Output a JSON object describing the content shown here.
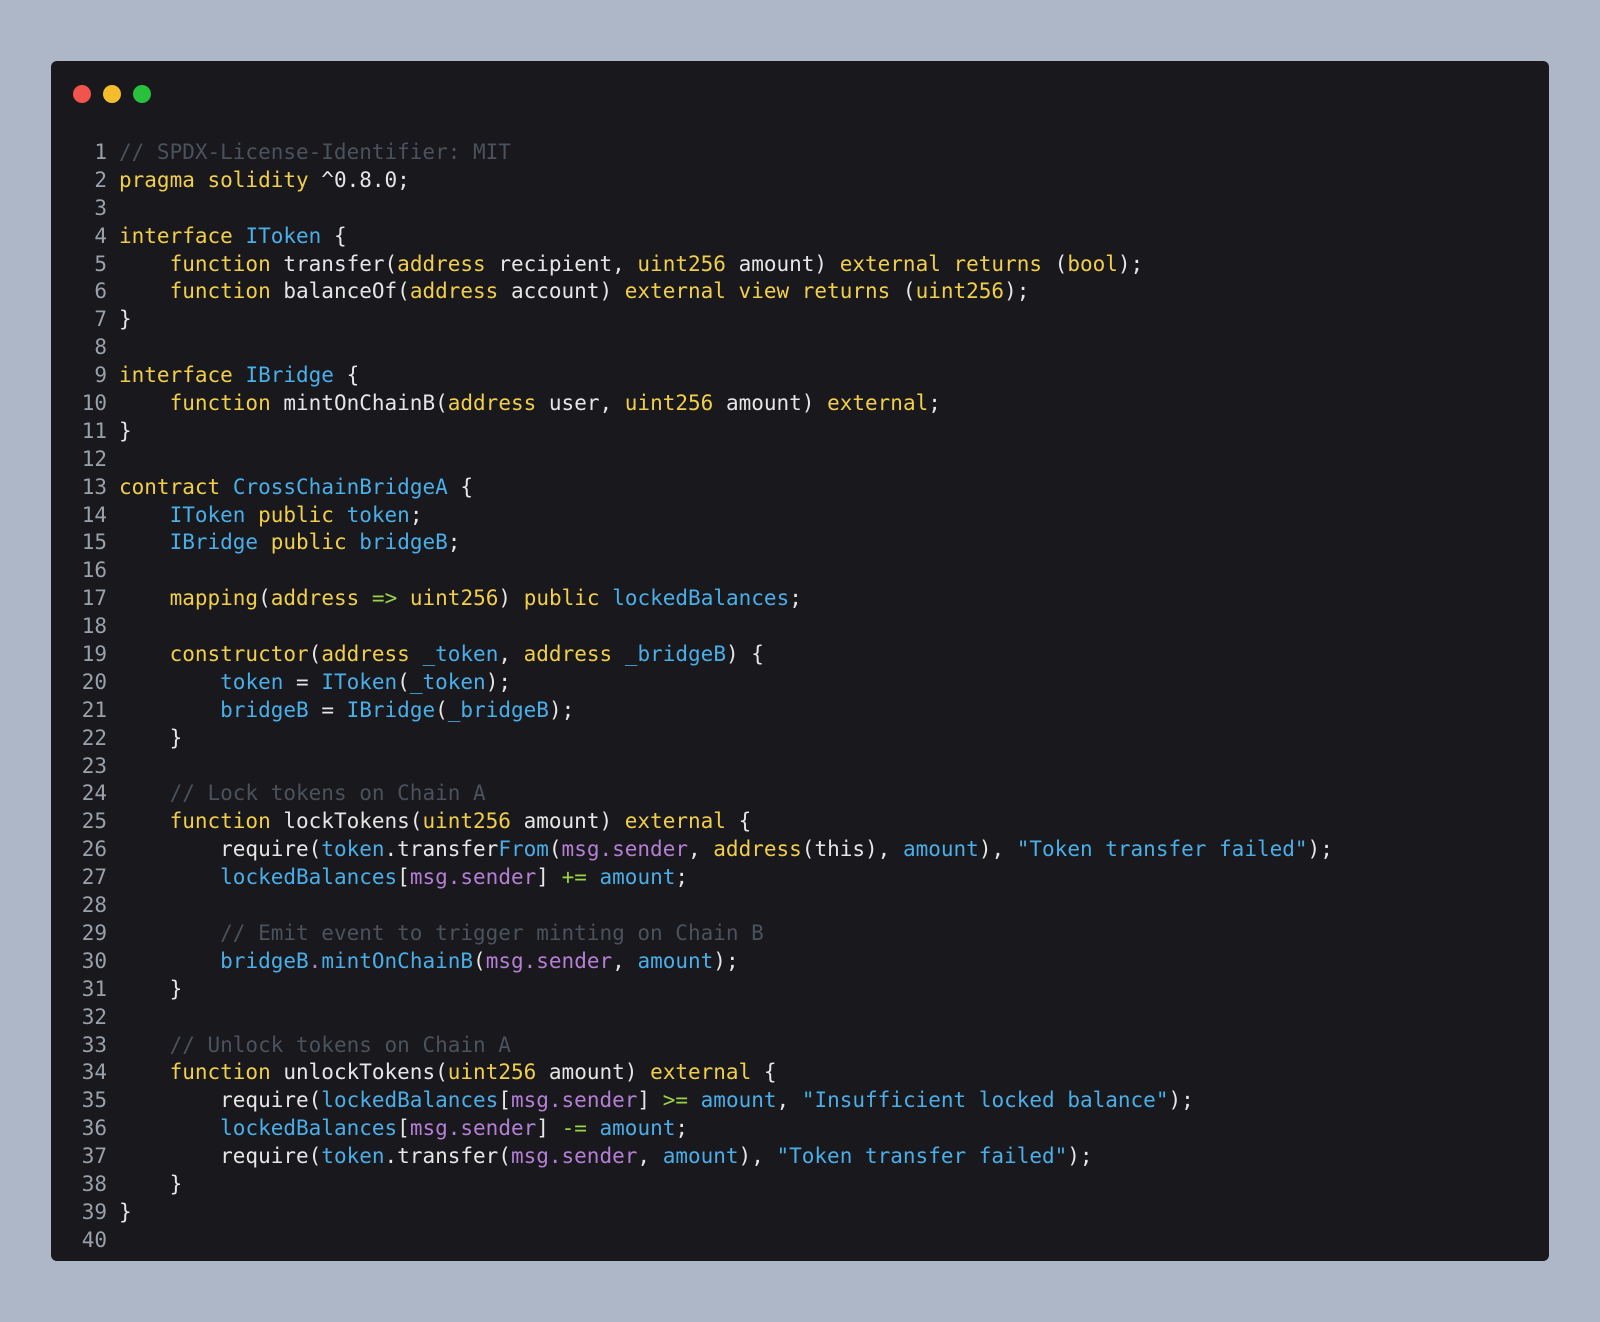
{
  "window_controls": {
    "close_color": "#f0544c",
    "minimize_color": "#f5bd2e",
    "maximize_color": "#27c13e"
  },
  "colors": {
    "background": "#adb7c8",
    "editor_background": "#18181d",
    "plain": "#e6e6e6",
    "keyword": "#f2cf4a",
    "type": "#4aaee8",
    "property": "#b57fd6",
    "string": "#4aaee8",
    "operator": "#9bd349",
    "comment": "#4b525c",
    "line_number": "#9aa1ab"
  },
  "code_lines": [
    {
      "num": "1",
      "tokens": [
        [
          "comment",
          "// SPDX-License-Identifier: MIT"
        ]
      ]
    },
    {
      "num": "2",
      "tokens": [
        [
          "kw",
          "pragma solidity"
        ],
        [
          "plain",
          " ^0.8.0;"
        ]
      ]
    },
    {
      "num": "3",
      "tokens": []
    },
    {
      "num": "4",
      "tokens": [
        [
          "kw",
          "interface"
        ],
        [
          "plain",
          " "
        ],
        [
          "type",
          "IToken"
        ],
        [
          "plain",
          " {"
        ]
      ]
    },
    {
      "num": "5",
      "tokens": [
        [
          "plain",
          "    "
        ],
        [
          "kw",
          "function"
        ],
        [
          "plain",
          " transfer("
        ],
        [
          "kw",
          "address"
        ],
        [
          "plain",
          " recipient, "
        ],
        [
          "kw",
          "uint256"
        ],
        [
          "plain",
          " amount) "
        ],
        [
          "kw",
          "external returns"
        ],
        [
          "plain",
          " ("
        ],
        [
          "kw",
          "bool"
        ],
        [
          "plain",
          ");"
        ]
      ]
    },
    {
      "num": "6",
      "tokens": [
        [
          "plain",
          "    "
        ],
        [
          "kw",
          "function"
        ],
        [
          "plain",
          " balanceOf("
        ],
        [
          "kw",
          "address"
        ],
        [
          "plain",
          " account) "
        ],
        [
          "kw",
          "external view returns"
        ],
        [
          "plain",
          " ("
        ],
        [
          "kw",
          "uint256"
        ],
        [
          "plain",
          ");"
        ]
      ]
    },
    {
      "num": "7",
      "tokens": [
        [
          "plain",
          "}"
        ]
      ]
    },
    {
      "num": "8",
      "tokens": []
    },
    {
      "num": "9",
      "tokens": [
        [
          "kw",
          "interface"
        ],
        [
          "plain",
          " "
        ],
        [
          "type",
          "IBridge"
        ],
        [
          "plain",
          " {"
        ]
      ]
    },
    {
      "num": "10",
      "tokens": [
        [
          "plain",
          "    "
        ],
        [
          "kw",
          "function"
        ],
        [
          "plain",
          " mintOnChainB("
        ],
        [
          "kw",
          "address"
        ],
        [
          "plain",
          " user, "
        ],
        [
          "kw",
          "uint256"
        ],
        [
          "plain",
          " amount) "
        ],
        [
          "kw",
          "external"
        ],
        [
          "plain",
          ";"
        ]
      ]
    },
    {
      "num": "11",
      "tokens": [
        [
          "plain",
          "}"
        ]
      ]
    },
    {
      "num": "12",
      "tokens": []
    },
    {
      "num": "13",
      "tokens": [
        [
          "kw",
          "contract"
        ],
        [
          "plain",
          " "
        ],
        [
          "type",
          "CrossChainBridgeA"
        ],
        [
          "plain",
          " {"
        ]
      ]
    },
    {
      "num": "14",
      "tokens": [
        [
          "plain",
          "    "
        ],
        [
          "type",
          "IToken"
        ],
        [
          "plain",
          " "
        ],
        [
          "kw",
          "public"
        ],
        [
          "plain",
          " "
        ],
        [
          "type",
          "token"
        ],
        [
          "plain",
          ";"
        ]
      ]
    },
    {
      "num": "15",
      "tokens": [
        [
          "plain",
          "    "
        ],
        [
          "type",
          "IBridge"
        ],
        [
          "plain",
          " "
        ],
        [
          "kw",
          "public"
        ],
        [
          "plain",
          " "
        ],
        [
          "type",
          "bridgeB"
        ],
        [
          "plain",
          ";"
        ]
      ]
    },
    {
      "num": "16",
      "tokens": []
    },
    {
      "num": "17",
      "tokens": [
        [
          "plain",
          "    "
        ],
        [
          "kw",
          "mapping"
        ],
        [
          "plain",
          "("
        ],
        [
          "kw",
          "address"
        ],
        [
          "plain",
          " "
        ],
        [
          "op",
          "=>"
        ],
        [
          "plain",
          " "
        ],
        [
          "kw",
          "uint256"
        ],
        [
          "plain",
          ") "
        ],
        [
          "kw",
          "public"
        ],
        [
          "plain",
          " "
        ],
        [
          "type",
          "lockedBalances"
        ],
        [
          "plain",
          ";"
        ]
      ]
    },
    {
      "num": "18",
      "tokens": []
    },
    {
      "num": "19",
      "tokens": [
        [
          "plain",
          "    "
        ],
        [
          "kw",
          "constructor"
        ],
        [
          "plain",
          "("
        ],
        [
          "kw",
          "address"
        ],
        [
          "plain",
          " "
        ],
        [
          "type",
          "_token"
        ],
        [
          "plain",
          ", "
        ],
        [
          "kw",
          "address"
        ],
        [
          "plain",
          " "
        ],
        [
          "type",
          "_bridgeB"
        ],
        [
          "plain",
          ") {"
        ]
      ]
    },
    {
      "num": "20",
      "tokens": [
        [
          "plain",
          "        "
        ],
        [
          "type",
          "token"
        ],
        [
          "plain",
          " = "
        ],
        [
          "type",
          "IToken"
        ],
        [
          "plain",
          "("
        ],
        [
          "type",
          "_token"
        ],
        [
          "plain",
          ");"
        ]
      ]
    },
    {
      "num": "21",
      "tokens": [
        [
          "plain",
          "        "
        ],
        [
          "type",
          "bridgeB"
        ],
        [
          "plain",
          " = "
        ],
        [
          "type",
          "IBridge"
        ],
        [
          "plain",
          "("
        ],
        [
          "type",
          "_bridgeB"
        ],
        [
          "plain",
          ");"
        ]
      ]
    },
    {
      "num": "22",
      "tokens": [
        [
          "plain",
          "    }"
        ]
      ]
    },
    {
      "num": "23",
      "tokens": []
    },
    {
      "num": "24",
      "tokens": [
        [
          "plain",
          "    "
        ],
        [
          "comment",
          "// Lock tokens on Chain A"
        ]
      ]
    },
    {
      "num": "25",
      "tokens": [
        [
          "plain",
          "    "
        ],
        [
          "kw",
          "function"
        ],
        [
          "plain",
          " lockTokens("
        ],
        [
          "kw",
          "uint256"
        ],
        [
          "plain",
          " amount) "
        ],
        [
          "kw",
          "external"
        ],
        [
          "plain",
          " {"
        ]
      ]
    },
    {
      "num": "26",
      "tokens": [
        [
          "plain",
          "        require("
        ],
        [
          "type",
          "token"
        ],
        [
          "plain",
          ".transfer"
        ],
        [
          "type",
          "From"
        ],
        [
          "plain",
          "("
        ],
        [
          "prop",
          "msg.sender"
        ],
        [
          "plain",
          ", "
        ],
        [
          "kw",
          "address"
        ],
        [
          "plain",
          "(this), "
        ],
        [
          "type",
          "amount"
        ],
        [
          "plain",
          "), "
        ],
        [
          "str",
          "\"Token transfer failed\""
        ],
        [
          "plain",
          ");"
        ]
      ]
    },
    {
      "num": "27",
      "tokens": [
        [
          "plain",
          "        "
        ],
        [
          "type",
          "lockedBalances"
        ],
        [
          "plain",
          "["
        ],
        [
          "prop",
          "msg.sender"
        ],
        [
          "plain",
          "] "
        ],
        [
          "op",
          "+="
        ],
        [
          "plain",
          " "
        ],
        [
          "type",
          "amount"
        ],
        [
          "plain",
          ";"
        ]
      ]
    },
    {
      "num": "28",
      "tokens": []
    },
    {
      "num": "29",
      "tokens": [
        [
          "plain",
          "        "
        ],
        [
          "comment",
          "// Emit event to trigger minting on Chain B"
        ]
      ]
    },
    {
      "num": "30",
      "tokens": [
        [
          "plain",
          "        "
        ],
        [
          "type",
          "bridgeB"
        ],
        [
          "prop",
          "."
        ],
        [
          "type",
          "mintOnChainB"
        ],
        [
          "plain",
          "("
        ],
        [
          "prop",
          "msg.sender"
        ],
        [
          "plain",
          ", "
        ],
        [
          "type",
          "amount"
        ],
        [
          "plain",
          ");"
        ]
      ]
    },
    {
      "num": "31",
      "tokens": [
        [
          "plain",
          "    }"
        ]
      ]
    },
    {
      "num": "32",
      "tokens": []
    },
    {
      "num": "33",
      "tokens": [
        [
          "plain",
          "    "
        ],
        [
          "comment",
          "// Unlock tokens on Chain A"
        ]
      ]
    },
    {
      "num": "34",
      "tokens": [
        [
          "plain",
          "    "
        ],
        [
          "kw",
          "function"
        ],
        [
          "plain",
          " unlockTokens("
        ],
        [
          "kw",
          "uint256"
        ],
        [
          "plain",
          " amount) "
        ],
        [
          "kw",
          "external"
        ],
        [
          "plain",
          " {"
        ]
      ]
    },
    {
      "num": "35",
      "tokens": [
        [
          "plain",
          "        require("
        ],
        [
          "type",
          "lockedBalances"
        ],
        [
          "plain",
          "["
        ],
        [
          "prop",
          "msg.sender"
        ],
        [
          "plain",
          "] "
        ],
        [
          "op",
          ">="
        ],
        [
          "plain",
          " "
        ],
        [
          "type",
          "amount"
        ],
        [
          "plain",
          ", "
        ],
        [
          "str",
          "\"Insufficient locked balance\""
        ],
        [
          "plain",
          ");"
        ]
      ]
    },
    {
      "num": "36",
      "tokens": [
        [
          "plain",
          "        "
        ],
        [
          "type",
          "lockedBalances"
        ],
        [
          "plain",
          "["
        ],
        [
          "prop",
          "msg.sender"
        ],
        [
          "plain",
          "] "
        ],
        [
          "op",
          "-="
        ],
        [
          "plain",
          " "
        ],
        [
          "type",
          "amount"
        ],
        [
          "plain",
          ";"
        ]
      ]
    },
    {
      "num": "37",
      "tokens": [
        [
          "plain",
          "        require("
        ],
        [
          "type",
          "token"
        ],
        [
          "plain",
          ".transfer("
        ],
        [
          "prop",
          "msg.sender"
        ],
        [
          "plain",
          ", "
        ],
        [
          "type",
          "amount"
        ],
        [
          "plain",
          "), "
        ],
        [
          "str",
          "\"Token transfer failed\""
        ],
        [
          "plain",
          ");"
        ]
      ]
    },
    {
      "num": "38",
      "tokens": [
        [
          "plain",
          "    }"
        ]
      ]
    },
    {
      "num": "39",
      "tokens": [
        [
          "plain",
          "}"
        ]
      ]
    },
    {
      "num": "40",
      "tokens": []
    }
  ]
}
